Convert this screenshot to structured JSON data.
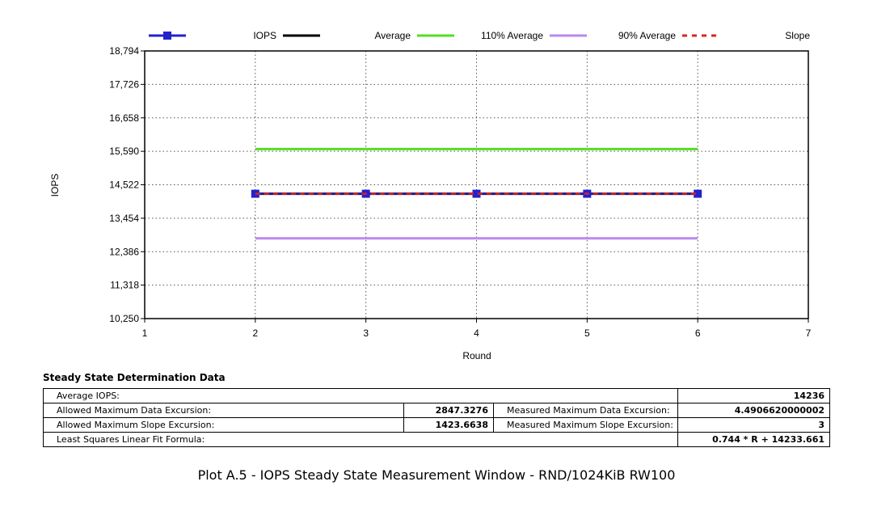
{
  "chart_data": {
    "type": "line",
    "ylabel": "IOPS",
    "xlabel": "Round",
    "xlim": [
      1,
      7
    ],
    "ylim": [
      10250,
      18794
    ],
    "x_ticks": [
      "1",
      "2",
      "3",
      "4",
      "5",
      "6",
      "7"
    ],
    "y_ticks": [
      "10,250",
      "11,318",
      "12,386",
      "13,454",
      "14,522",
      "15,590",
      "16,658",
      "17,726",
      "18,794"
    ],
    "grid": "dotted",
    "legend_position": "top",
    "series": [
      {
        "name": "IOPS",
        "x": [
          2,
          3,
          4,
          5,
          6
        ],
        "values": [
          14236,
          14236,
          14236,
          14236,
          14236
        ],
        "color": "#2222cc",
        "style": "line-square-markers"
      },
      {
        "name": "Average",
        "x": [
          2,
          6
        ],
        "values": [
          14236,
          14236
        ],
        "color": "#000000",
        "style": "solid"
      },
      {
        "name": "110% Average",
        "x": [
          2,
          6
        ],
        "values": [
          15660,
          15660
        ],
        "color": "#55dd22",
        "style": "solid"
      },
      {
        "name": "90% Average",
        "x": [
          2,
          6
        ],
        "values": [
          12812,
          12812
        ],
        "color": "#bb88ee",
        "style": "solid"
      },
      {
        "name": "Slope",
        "x": [
          2,
          6
        ],
        "values": [
          14235.15,
          14238.13
        ],
        "color": "#dd2222",
        "style": "dashed"
      }
    ]
  },
  "table": {
    "title": "Steady State Determination Data",
    "average_iops_label": "Average IOPS:",
    "average_iops_value": "14236",
    "allowed_data_label": "Allowed Maximum Data Excursion:",
    "allowed_data_value": "2847.3276",
    "measured_data_label": "Measured Maximum Data Excursion:",
    "measured_data_value": "4.4906620000002",
    "allowed_slope_label": "Allowed Maximum Slope Excursion:",
    "allowed_slope_value": "1423.6638",
    "measured_slope_label": "Measured Maximum Slope Excursion:",
    "measured_slope_value": "3",
    "fit_label": "Least Squares Linear Fit Formula:",
    "fit_value": "0.744 * R + 14233.661"
  },
  "caption": "Plot A.5 - IOPS Steady State Measurement Window - RND/1024KiB RW100"
}
